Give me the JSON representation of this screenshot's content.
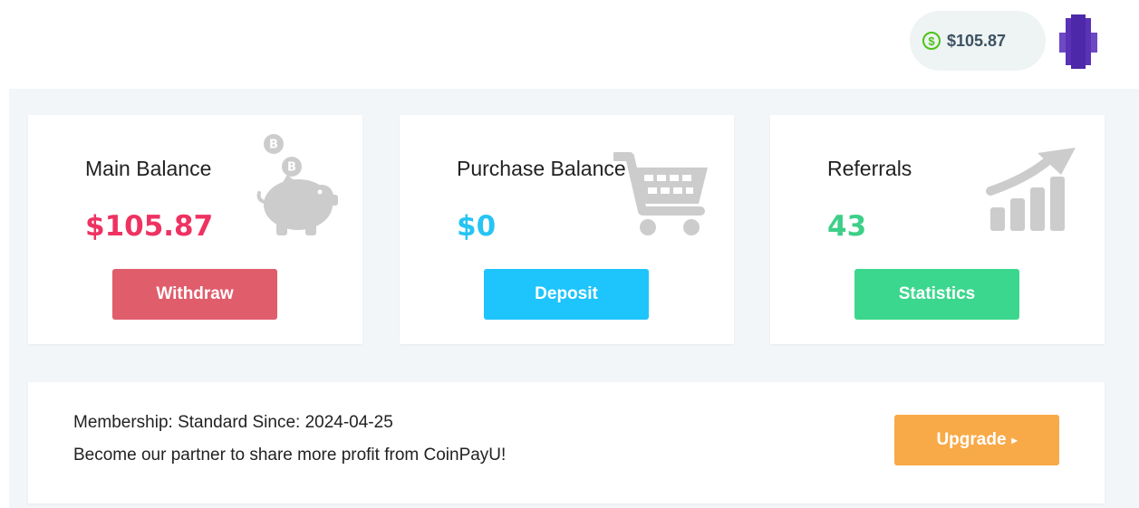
{
  "header": {
    "balance": "$105.87",
    "balance_icon": "dollar-circle-icon",
    "accent_green": "#4cc317"
  },
  "cards": [
    {
      "title": "Main Balance",
      "value": "$105.87",
      "button": "Withdraw",
      "icon": "piggy-bank-icon",
      "color": "#ee3261",
      "button_color": "#e05d6c"
    },
    {
      "title": "Purchase Balance",
      "value": "$0",
      "button": "Deposit",
      "icon": "shopping-cart-icon",
      "color": "#26c4f3",
      "button_color": "#1ec4fc"
    },
    {
      "title": "Referrals",
      "value": "43",
      "button": "Statistics",
      "icon": "growth-chart-icon",
      "color": "#3ccf88",
      "button_color": "#3cd78e"
    }
  ],
  "membership": {
    "line1": "Membership: Standard Since: 2024-04-25",
    "line2": "Become our partner to share more profit from CoinPayU!",
    "upgrade_label": "Upgrade",
    "upgrade_color": "#f8aa48"
  }
}
